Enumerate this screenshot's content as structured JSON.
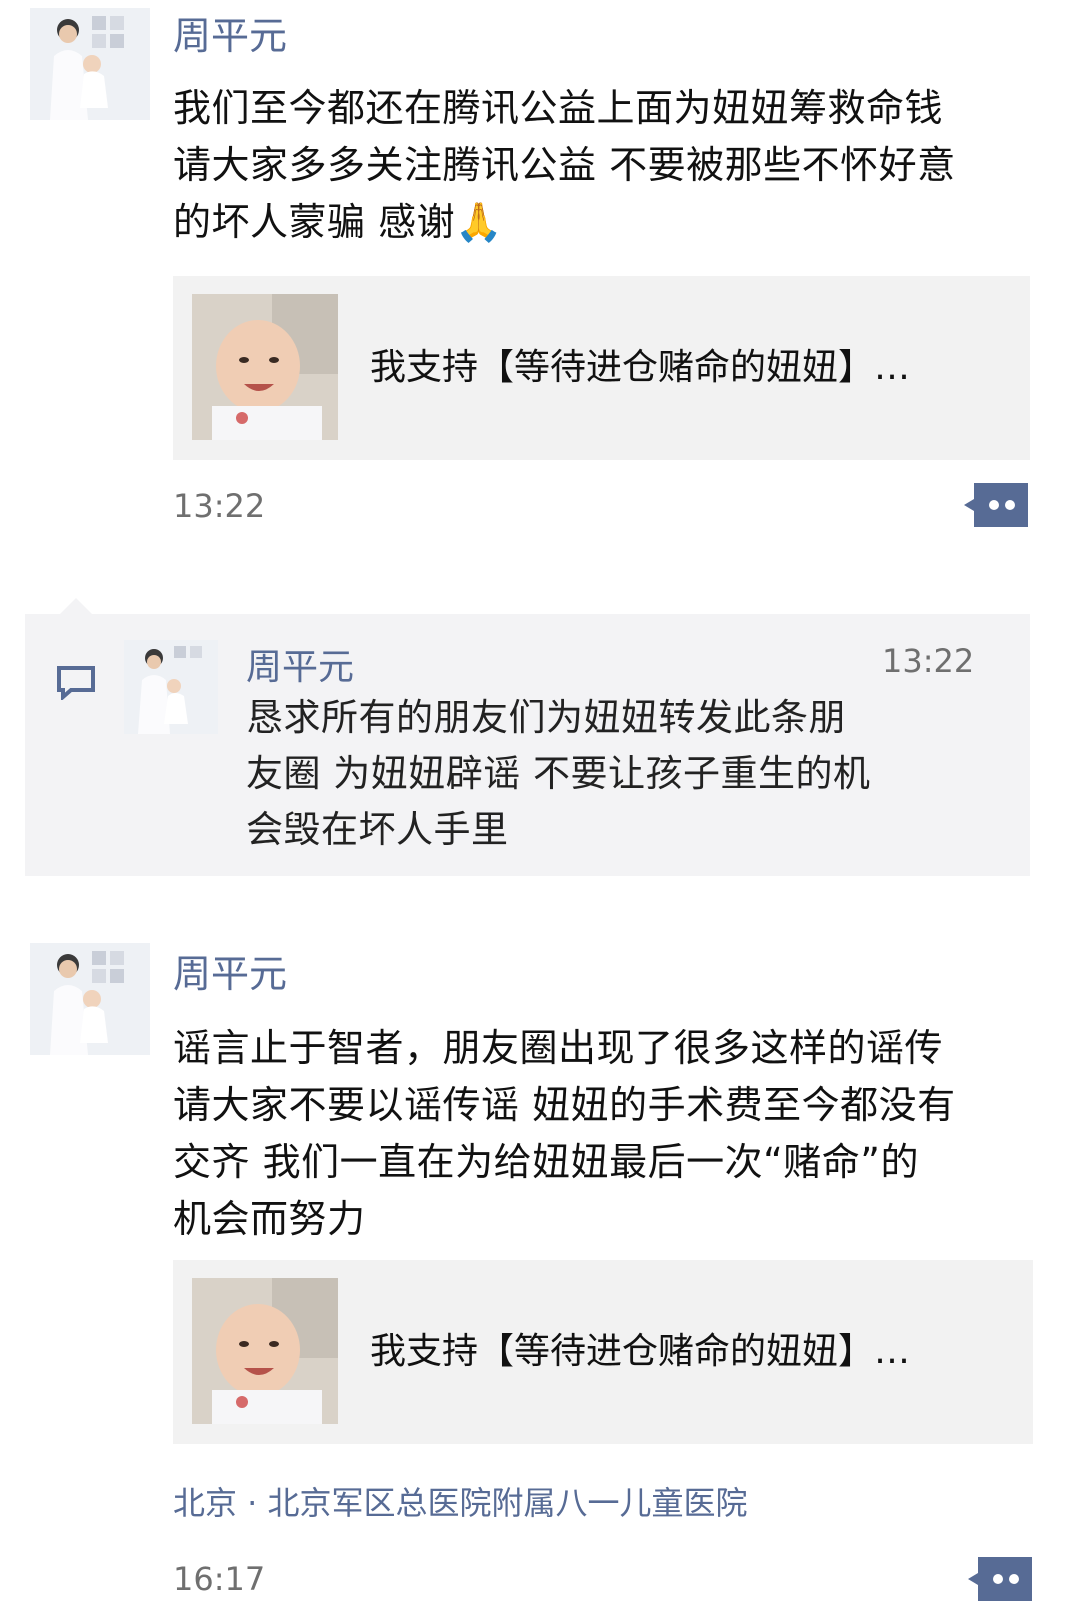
{
  "post1": {
    "author": "周平元",
    "text": "我们至今都还在腾讯公益上面为妞妞筹救命钱\n请大家多多关注腾讯公益 不要被那些不怀好意\n的坏人蒙骗 感谢🙏",
    "card_title": "我支持【等待进仓赌命的妞妞】…",
    "time": "13:22"
  },
  "comment": {
    "author": "周平元",
    "time": "13:22",
    "text": "恳求所有的朋友们为妞妞转发此条朋\n友圈 为妞妞辟谣 不要让孩子重生的机\n会毁在坏人手里"
  },
  "post2": {
    "author": "周平元",
    "text": "谣言止于智者，朋友圈出现了很多这样的谣传\n请大家不要以谣传谣 妞妞的手术费至今都没有\n交齐 我们一直在为给妞妞最后一次“赌命”的\n机会而努力",
    "card_title": "我支持【等待进仓赌命的妞妞】…",
    "location": "北京 · 北京军区总医院附属八一儿童医院",
    "time": "16:17"
  },
  "icons": {
    "more": "more-comment-icon",
    "comment": "comment-bubble-icon"
  },
  "colors": {
    "name_link": "#576b95",
    "card_bg": "#f2f2f2",
    "more_btn": "#576b95"
  }
}
